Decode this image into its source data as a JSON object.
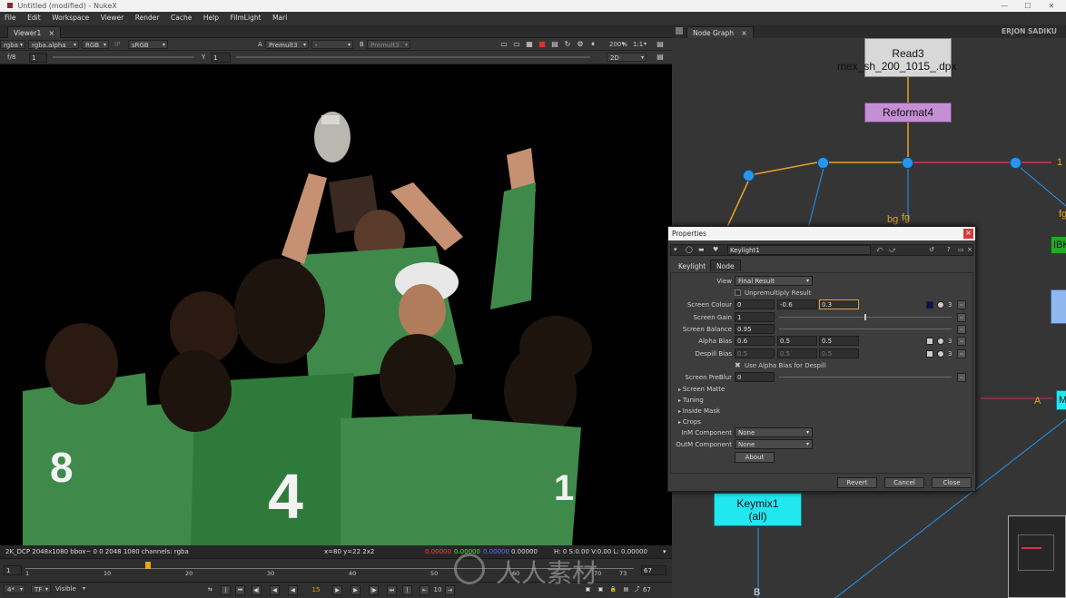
{
  "window": {
    "title": "Untitled (modified) - NukeX",
    "user": "ERJON SADIKU"
  },
  "menu": [
    "File",
    "Edit",
    "Workspace",
    "Viewer",
    "Render",
    "Cache",
    "Help",
    "FilmLight",
    "Mari"
  ],
  "viewer": {
    "tab": "Viewer1",
    "channels": "rgba",
    "alpha": "rgba.alpha",
    "display": "RGB",
    "ip": "IP",
    "lut": "sRGB",
    "input_a_label": "A",
    "input_a": "Premult3",
    "input_mid": "-",
    "input_b_label": "B",
    "input_b": "Premult3",
    "zoom": "200%",
    "ratio": "1:1",
    "gain_label": "f/8",
    "gain_value": "1",
    "gamma_label": "Y",
    "gamma_value": "1",
    "mode": "2D",
    "status_format": "2K_DCP 2048x1080  bbox~ 0 0 2048 1080 channels: rgba",
    "status_pos": "x=80 y=22 2x2",
    "status_r": "0.00000",
    "status_g": "0.00000",
    "status_b": "0.00000",
    "status_a": "0.00000",
    "status_hsv": "H: 0 S:0.00 V:0.00  L: 0.00000"
  },
  "timeline": {
    "start": "1",
    "end": "67",
    "ticks": [
      "1",
      "10",
      "20",
      "30",
      "40",
      "50",
      "60",
      "70",
      "73"
    ],
    "current": "15",
    "fps_mode": "TF",
    "visible": "Visible",
    "step": "10",
    "end_frame": "67",
    "in_label": "4*"
  },
  "nodegraph": {
    "tab": "Node Graph",
    "nodes": {
      "read": "Read3",
      "read_file": "mex_sh_200_1015_.dpx",
      "reformat": "Reformat4",
      "keymix": "Keymix1",
      "keymix_sub": "(all)",
      "ibk": "IBK",
      "mer": "Me"
    },
    "labels": {
      "bg": "bg",
      "fg": "fg",
      "fg2": "fg",
      "a": "A",
      "b": "B",
      "one": "1"
    }
  },
  "properties": {
    "title": "Properties",
    "node_name": "Keylight1",
    "tabs": [
      "Keylight",
      "Node"
    ],
    "view_label": "View",
    "view_value": "Final Result",
    "unpremultiply": "Unpremultiply Result",
    "screen_colour_label": "Screen Colour",
    "screen_colour": [
      "0",
      "-0.6",
      "0.3"
    ],
    "screen_colour_count": "3",
    "screen_gain_label": "Screen Gain",
    "screen_gain": "1",
    "screen_balance_label": "Screen Balance",
    "screen_balance": "0.95",
    "alpha_bias_label": "Alpha Bias",
    "alpha_bias": [
      "0.6",
      "0.5",
      "0.5"
    ],
    "alpha_bias_count": "3",
    "despill_bias_label": "Despill Bias",
    "despill_bias": [
      "0.5",
      "0.5",
      "0.5"
    ],
    "despill_bias_count": "3",
    "use_alpha_bias": "Use Alpha Bias for Despill",
    "screen_preblur_label": "Screen PreBlur",
    "screen_preblur": "0",
    "sections": [
      "Screen Matte",
      "Tuning",
      "Inside Mask",
      "Crops"
    ],
    "inm_label": "InM Component",
    "inm_value": "None",
    "outm_label": "OutM Component",
    "outm_value": "None",
    "about": "About",
    "revert": "Revert",
    "cancel": "Cancel",
    "close": "Close",
    "slider_ticks": [
      "0",
      "0.1",
      "0.2",
      "0.3",
      "0.4",
      "0.5",
      "0.6",
      "0.7",
      "0.8",
      "0.9",
      "1"
    ]
  },
  "watermark": "人人素材",
  "colors": {
    "accent": "#e6a323",
    "node_read": "#d8d8d8",
    "node_reformat": "#c58fd6",
    "node_keymix": "#22e6f0",
    "dot": "#2896ef",
    "selected": "#e8a040"
  }
}
